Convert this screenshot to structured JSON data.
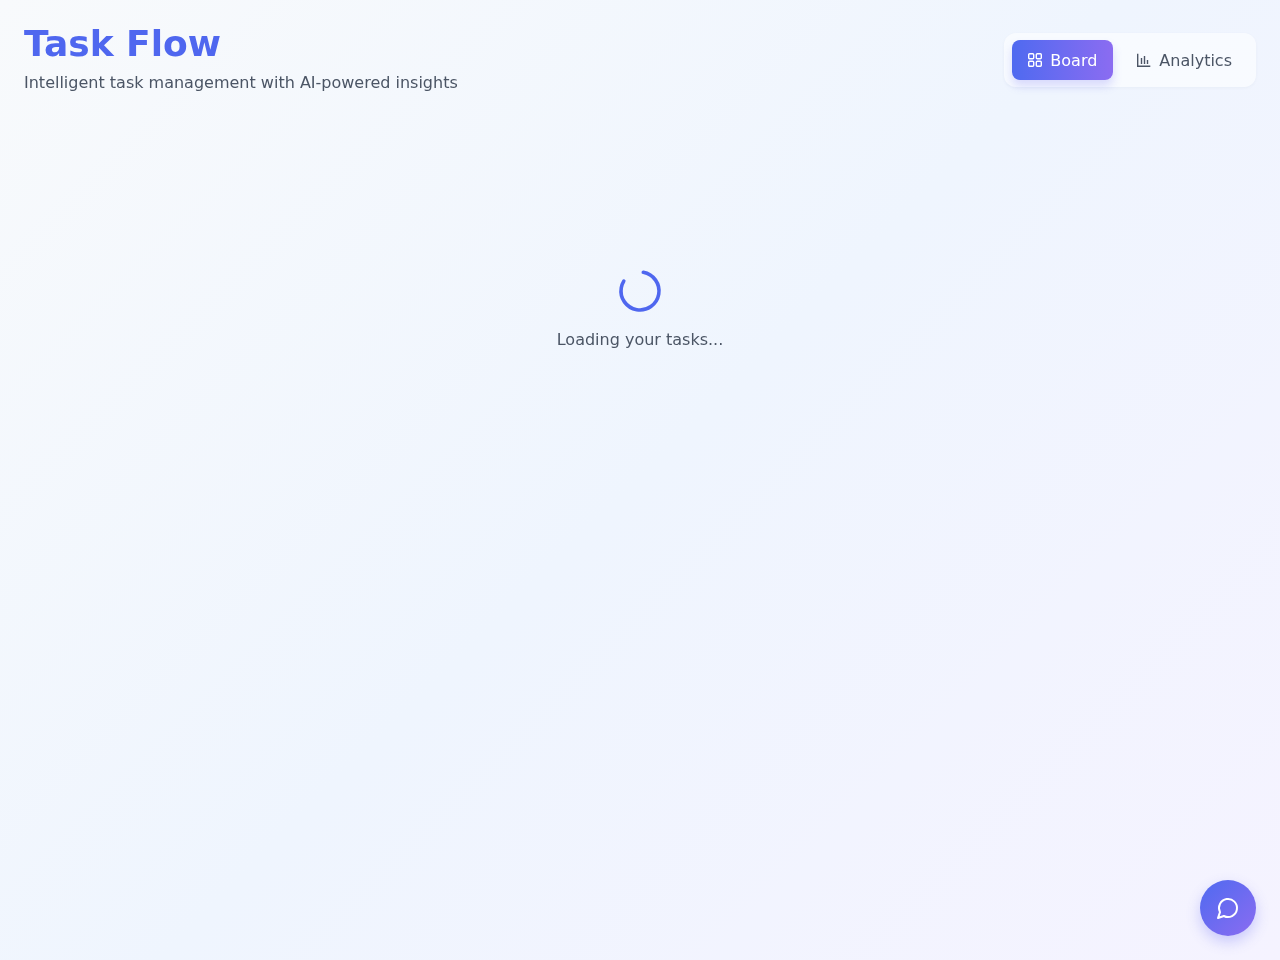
{
  "header": {
    "title": "Task Flow",
    "subtitle": "Intelligent task management with AI-powered insights"
  },
  "view_tabs": [
    {
      "label": "Board",
      "selected": true
    },
    {
      "label": "Analytics",
      "selected": false
    }
  ],
  "loading": {
    "message": "Loading your tasks..."
  }
}
